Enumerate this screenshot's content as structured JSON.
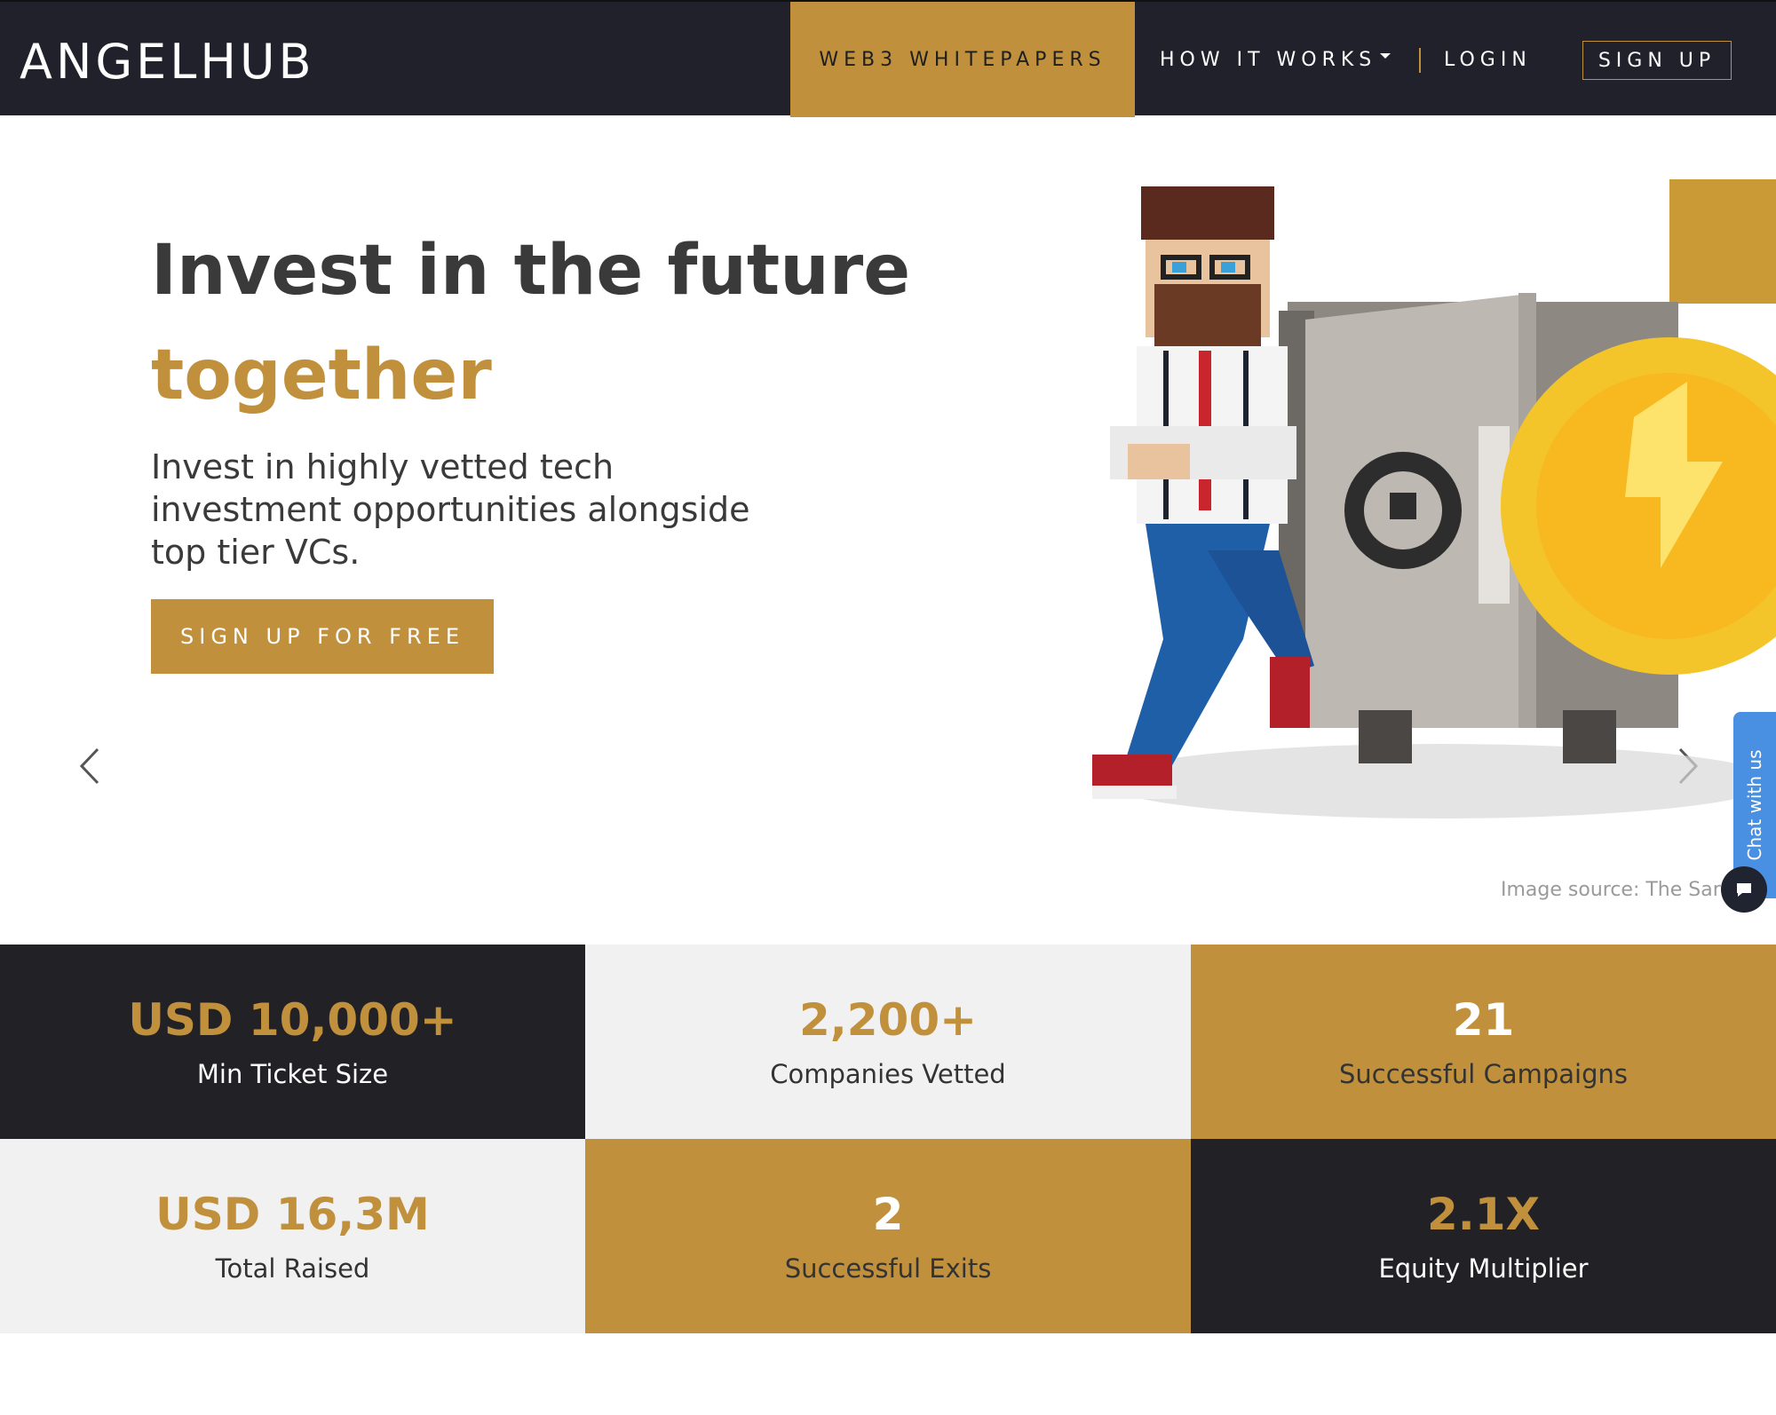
{
  "nav": {
    "logo": "ANGELHUB",
    "web3": "WEB3 WHITEPAPERS",
    "how": "HOW IT WORKS",
    "login": "LOGIN",
    "signup": "SIGN UP"
  },
  "hero": {
    "title": "Invest in the future",
    "title_accent": "together",
    "subtitle": "Invest in highly vetted tech investment opportunities alongside top tier VCs.",
    "cta": "SIGN UP FOR FREE",
    "image_source": "Image source: The Sar"
  },
  "chat": {
    "label": "Chat with us"
  },
  "stats": [
    {
      "value": "USD 10,000+",
      "label": "Min Ticket Size"
    },
    {
      "value": "2,200+",
      "label": "Companies Vetted"
    },
    {
      "value": "21",
      "label": "Successful Campaigns"
    },
    {
      "value": "USD 16,3M",
      "label": "Total Raised"
    },
    {
      "value": "2",
      "label": "Successful Exits"
    },
    {
      "value": "2.1X",
      "label": "Equity Multiplier"
    }
  ],
  "colors": {
    "gold": "#c0903c",
    "dark": "#222226",
    "navbar": "#21212b",
    "light": "#f1f1f1",
    "chat_blue": "#4a90e2"
  }
}
